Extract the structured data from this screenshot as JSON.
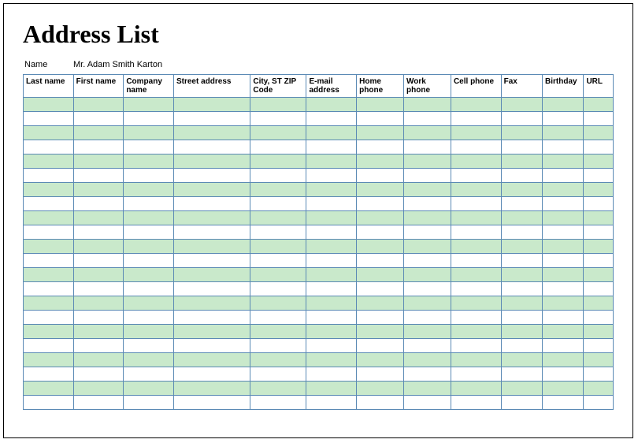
{
  "title": "Address List",
  "nameLabel": "Name",
  "nameValue": "Mr. Adam Smith Karton",
  "headers": {
    "lastName": "Last name",
    "firstName": "First name",
    "company": "Company name",
    "street": "Street address",
    "city": "City, ST  ZIP Code",
    "email": "E-mail address",
    "homePhone": "Home phone",
    "workPhone": "Work phone",
    "cellPhone": "Cell phone",
    "fax": "Fax",
    "birthday": "Birthday",
    "url": "URL"
  },
  "rowCount": 22
}
